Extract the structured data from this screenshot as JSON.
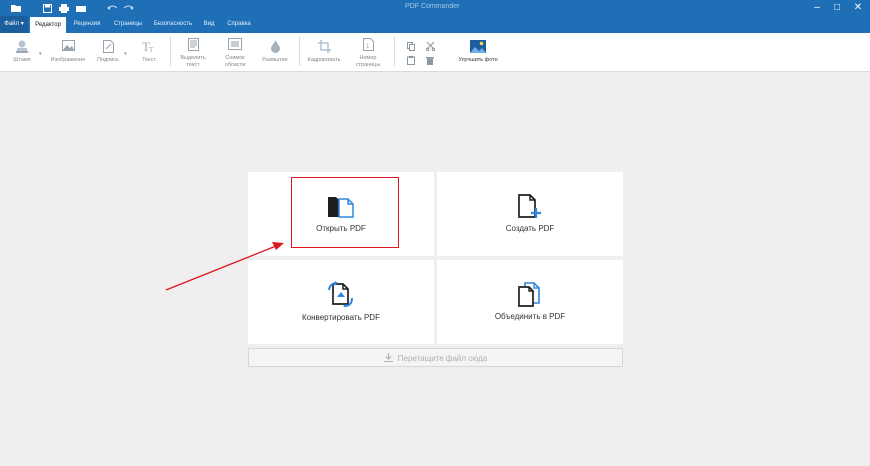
{
  "window": {
    "title": "PDF Commander",
    "controls": {
      "minimize": "–",
      "maximize": "□",
      "close": "✕"
    }
  },
  "quick_access": {
    "icons": [
      "folder-open-icon",
      "save-icon",
      "print-icon",
      "scan-icon",
      "undo-icon",
      "redo-icon"
    ]
  },
  "menu": {
    "file_label": "Файл ▾",
    "tabs": [
      {
        "label": "Редактор",
        "active": true
      },
      {
        "label": "Рецензия",
        "active": false
      },
      {
        "label": "Страницы",
        "active": false
      },
      {
        "label": "Безопасность",
        "active": false
      },
      {
        "label": "Вид",
        "active": false
      },
      {
        "label": "Справка",
        "active": false
      }
    ]
  },
  "ribbon": {
    "stamp": "Штамп",
    "image": "Изображение",
    "signature": "Подпись",
    "text": "Текст",
    "select_text": "Выделить\nтекст",
    "snapshot": "Снимок\nобласти",
    "blur": "Размытие",
    "crop": "Кадрировать",
    "page_numbers": "Номер\nстраницы",
    "enhance_photo": "Улучшить фото"
  },
  "actions": {
    "open_pdf": "Открыть PDF",
    "create_pdf": "Создать PDF",
    "convert_pdf": "Конвертировать PDF",
    "merge_pdf": "Объединить в PDF"
  },
  "dropzone": {
    "label": "Перетащите файл сюда"
  },
  "colors": {
    "brand_blue": "#1e6fb5",
    "doc_blue": "#2e86de",
    "highlight_red": "#e0141e"
  }
}
